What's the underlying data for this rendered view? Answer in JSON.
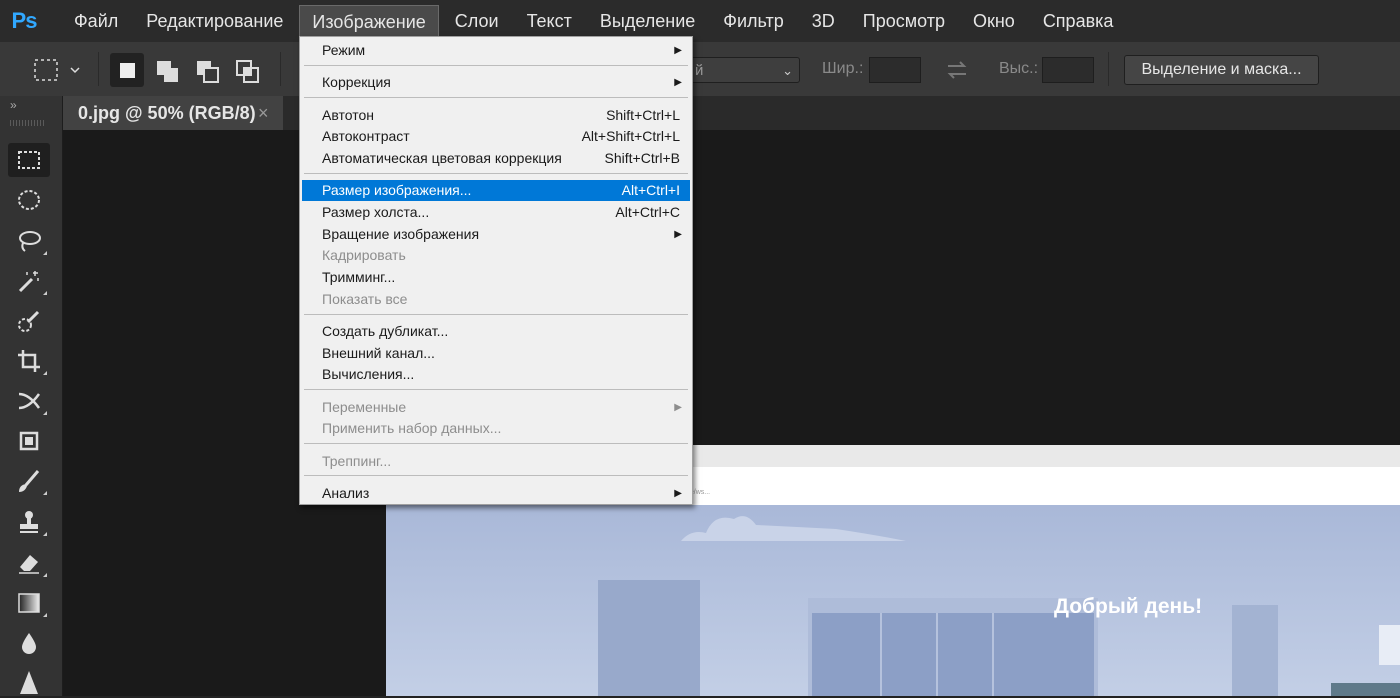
{
  "app": {
    "logo": "Ps"
  },
  "menubar": {
    "items": [
      "Файл",
      "Редактирование",
      "Изображение",
      "Слои",
      "Текст",
      "Выделение",
      "Фильтр",
      "3D",
      "Просмотр",
      "Окно",
      "Справка"
    ]
  },
  "options": {
    "select_value": "й",
    "width_label": "Шир.:",
    "height_label": "Выс.:",
    "mask_button": "Выделение и маска..."
  },
  "document": {
    "tab_title": "0.jpg @ 50% (RGB/8)",
    "close_glyph": "×",
    "image_url": "be/ws...",
    "greeting": "Добрый день!"
  },
  "image_menu": {
    "mode": "Режим",
    "adjustments": "Коррекция",
    "auto_tone": {
      "label": "Автотон",
      "shortcut": "Shift+Ctrl+L"
    },
    "auto_contrast": {
      "label": "Автоконтраст",
      "shortcut": "Alt+Shift+Ctrl+L"
    },
    "auto_color": {
      "label": "Автоматическая цветовая коррекция",
      "shortcut": "Shift+Ctrl+B"
    },
    "image_size": {
      "label": "Размер изображения...",
      "shortcut": "Alt+Ctrl+I"
    },
    "canvas_size": {
      "label": "Размер холста...",
      "shortcut": "Alt+Ctrl+C"
    },
    "image_rotation": "Вращение изображения",
    "crop": "Кадрировать",
    "trim": "Тримминг...",
    "reveal_all": "Показать все",
    "duplicate": "Создать дубликат...",
    "apply_image": "Внешний канал...",
    "calculations": "Вычисления...",
    "variables": "Переменные",
    "apply_data_set": "Применить набор данных...",
    "trap": "Треппинг...",
    "analysis": "Анализ",
    "submenu_glyph": "▶"
  },
  "colors": {
    "accent": "#0078d7",
    "ps_blue": "#31a8ff"
  }
}
